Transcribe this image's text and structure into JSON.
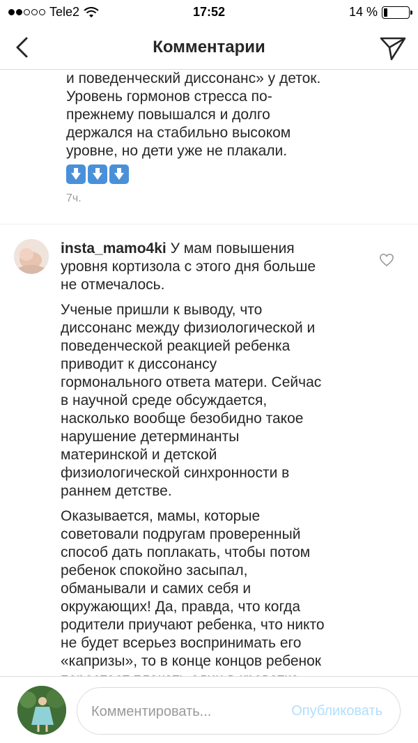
{
  "status_bar": {
    "carrier": "Tele2",
    "time": "17:52",
    "battery": "14 %"
  },
  "header": {
    "title": "Комментарии"
  },
  "comments": [
    {
      "text": "и поведенческий диссонанс» у деток.\nУровень гормонов стресса по-\nпрежнему повышался и долго\nдержался на стабильно высоком\nуровне, но дети уже не плакали.",
      "time": "7ч."
    },
    {
      "username": "insta_mamo4ki",
      "paragraphs": [
        " У мам повышения\nуровня кортизола с этого дня больше\nне отмечалось.",
        "Ученые пришли к выводу, что\nдиссонанс между физиологической и\nповеденческой реакцией ребенка\nприводит к диссонансу\nгормонального ответа матери. Сейчас\nв научной среде обсуждается,\nнасколько вообще безобидно такое\nнарушение детерминанты\nматеринской и детской\nфизиологической синхронности в\nраннем детстве.",
        "Оказывается, мамы, которые\nсоветовали подругам проверенный\nспособ дать поплакать, чтобы потом\nребенок спокойно засыпал,\nобманывали и самих себя и\nокружающих! Да, правда, что когда\nродители приучают ребенка, что никто\nне будет всерьез воспринимать его\n«капризы», то в конце концов ребенок\nперестает плакать один в кроватке."
      ]
    }
  ],
  "comment_input": {
    "placeholder": "Комментировать...",
    "publish_label": "Опубликовать"
  },
  "colors": {
    "text": "#262626",
    "muted": "#999999",
    "publish": "#b2dffc",
    "emoji": "#4a90d9"
  },
  "icons": [
    "back-chevron-icon",
    "direct-send-icon",
    "heart-icon",
    "down-arrow-emoji-icon"
  ]
}
